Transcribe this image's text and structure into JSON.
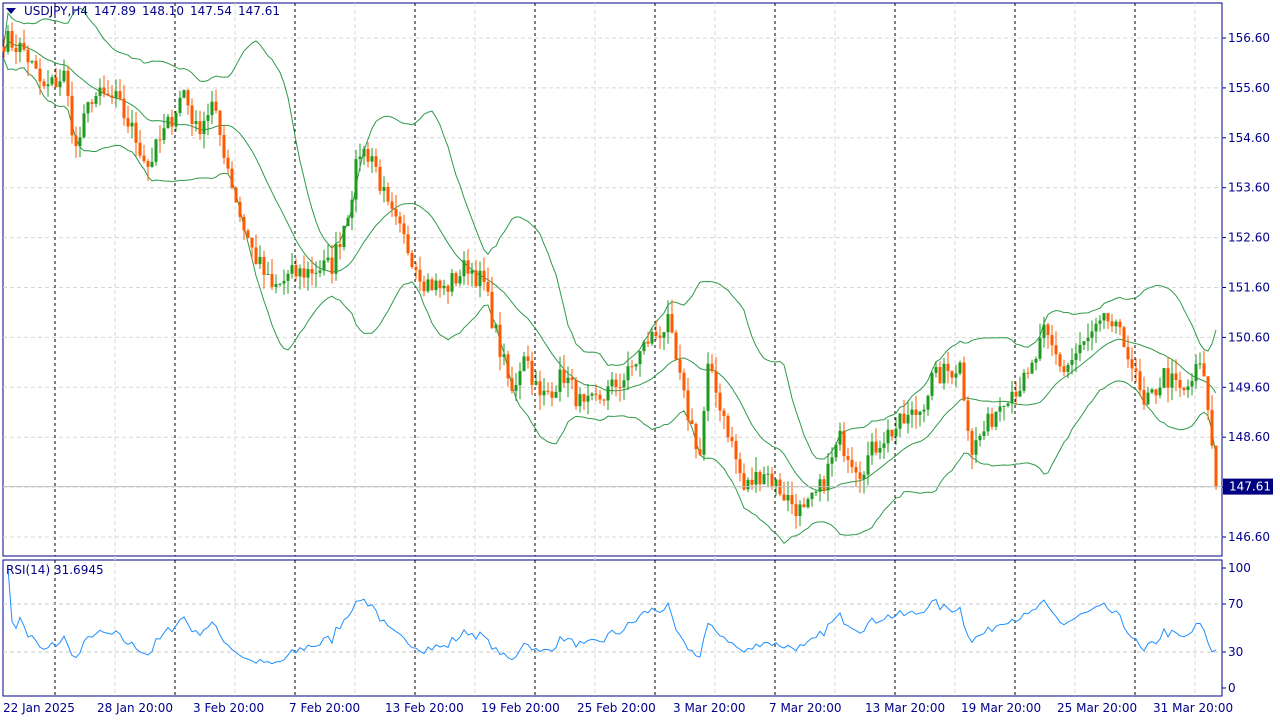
{
  "header": {
    "symbol": "USDJPY,H4",
    "open": "147.89",
    "high": "148.10",
    "low": "147.54",
    "close": "147.61"
  },
  "rsi": {
    "label": "RSI(14)",
    "value": "31.6945",
    "levels": [
      "100",
      "70",
      "30",
      "0"
    ]
  },
  "colors": {
    "bull": "#1f9a1f",
    "bear": "#ff5a00",
    "bands": "#2e9a4a",
    "rsi": "#1e90ff",
    "axis": "#00008b"
  },
  "chart_data": {
    "type": "candlestick",
    "title": "USDJPY,H4",
    "price_ticks": [
      "156.60",
      "155.60",
      "154.60",
      "153.60",
      "152.60",
      "151.60",
      "150.60",
      "149.60",
      "148.60",
      "147.60",
      "146.60"
    ],
    "ylim": [
      146.0,
      157.3
    ],
    "current_price": "147.61",
    "x_labels": [
      "22 Jan 2025",
      "28 Jan 20:00",
      "3 Feb 20:00",
      "7 Feb 20:00",
      "13 Feb 20:00",
      "19 Feb 20:00",
      "25 Feb 20:00",
      "3 Mar 20:00",
      "7 Mar 20:00",
      "13 Mar 20:00",
      "19 Mar 20:00",
      "25 Mar 20:00",
      "31 Mar 20:00"
    ],
    "indicators": [
      "Bollinger Bands(20,2)",
      "RSI(14)"
    ],
    "close_path": [
      [
        1,
        156.55
      ],
      [
        5,
        156.35
      ],
      [
        10,
        155.55
      ],
      [
        15,
        155.85
      ],
      [
        18,
        154.35
      ],
      [
        22,
        155.45
      ],
      [
        28,
        155.35
      ],
      [
        32,
        154.75
      ],
      [
        36,
        154.05
      ],
      [
        41,
        154.85
      ],
      [
        45,
        155.55
      ],
      [
        48,
        154.75
      ],
      [
        52,
        155.25
      ],
      [
        55,
        154.35
      ],
      [
        59,
        153.05
      ],
      [
        62,
        152.35
      ],
      [
        67,
        151.55
      ],
      [
        72,
        151.85
      ],
      [
        77,
        151.95
      ],
      [
        82,
        152.05
      ],
      [
        86,
        153.15
      ],
      [
        89,
        154.35
      ],
      [
        92,
        154.25
      ],
      [
        96,
        153.15
      ],
      [
        100,
        152.55
      ],
      [
        105,
        151.75
      ],
      [
        110,
        151.55
      ],
      [
        116,
        152.05
      ],
      [
        120,
        151.65
      ],
      [
        124,
        150.35
      ],
      [
        127,
        149.45
      ],
      [
        130,
        150.35
      ],
      [
        134,
        149.35
      ],
      [
        140,
        149.85
      ],
      [
        145,
        149.15
      ],
      [
        150,
        149.45
      ],
      [
        156,
        149.85
      ],
      [
        161,
        150.55
      ],
      [
        166,
        150.85
      ],
      [
        170,
        149.35
      ],
      [
        174,
        148.25
      ],
      [
        176,
        149.95
      ],
      [
        180,
        149.05
      ],
      [
        185,
        147.55
      ],
      [
        190,
        147.95
      ],
      [
        195,
        147.45
      ],
      [
        200,
        147.05
      ],
      [
        204,
        147.55
      ],
      [
        209,
        148.55
      ],
      [
        214,
        147.95
      ],
      [
        219,
        148.55
      ],
      [
        224,
        148.85
      ],
      [
        229,
        149.15
      ],
      [
        232,
        149.75
      ],
      [
        239,
        150.05
      ],
      [
        242,
        148.35
      ],
      [
        246,
        148.85
      ],
      [
        250,
        149.45
      ],
      [
        256,
        149.75
      ],
      [
        260,
        150.65
      ],
      [
        265,
        149.95
      ],
      [
        270,
        150.45
      ],
      [
        276,
        150.95
      ],
      [
        281,
        150.35
      ],
      [
        285,
        149.15
      ],
      [
        290,
        149.85
      ],
      [
        295,
        149.45
      ],
      [
        299,
        150.05
      ],
      [
        301,
        149.25
      ],
      [
        303,
        147.61
      ]
    ]
  }
}
